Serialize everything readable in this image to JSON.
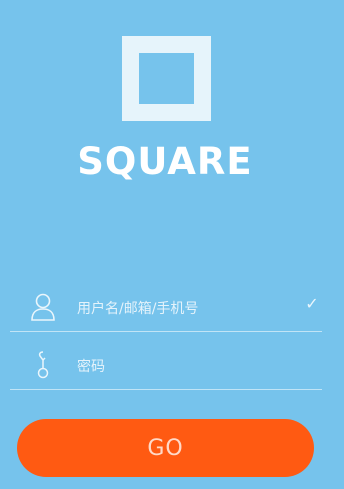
{
  "app": {
    "brand_name": "SQUARE",
    "colors": {
      "background": "#76c3ec",
      "logo_square": "#e6f4fb",
      "button": "#ff5a12",
      "button_text": "#ffd9c8",
      "field_text": "#e5f3fb"
    }
  },
  "form": {
    "username": {
      "icon": "user-icon",
      "placeholder": "用户名/邮箱/手机号",
      "status_icon": "check-icon",
      "status_glyph": "✓"
    },
    "password": {
      "icon": "key-icon",
      "placeholder": "密码"
    },
    "submit_label": "GO"
  }
}
